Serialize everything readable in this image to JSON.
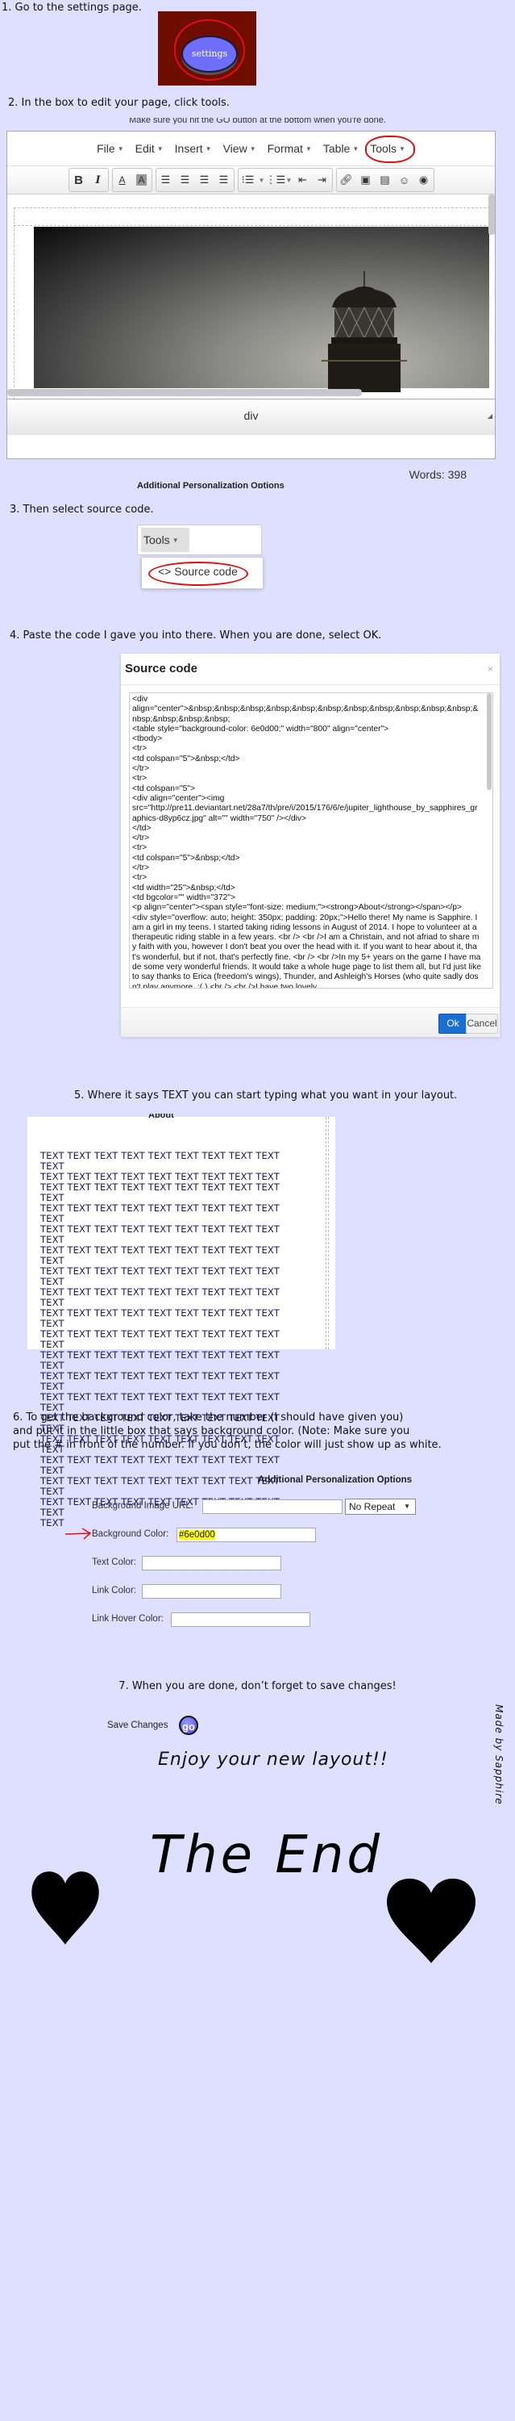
{
  "page": {
    "background_color": "#dfdfff",
    "steps": {
      "s1": "1. Go to the settings page.",
      "s2": "2. In the box to edit your page, click tools.",
      "s3": "3. Then select source code.",
      "s4": "4. Paste the code I gave you into there. When you are done, select OK.",
      "s5": "5. Where it says TEXT you can start typing what you want in your layout.",
      "s6_lines": [
        "6. To get the background color, take the number (I should have given you)",
        "and put it in the little box that says background color. (Note: Make sure you",
        "put the # in front of the number. If you don’t, the color will just show up as white."
      ],
      "s7": "7. When you are done, don’t forget to save changes!"
    }
  },
  "settings_button": {
    "label": "settings",
    "bg_color": "#6e0d00",
    "button_color": "#6e6efa"
  },
  "editor": {
    "cut_note": "Make sure you hit the GO button at the bottom when you're done.",
    "menus": [
      "File",
      "Edit",
      "Insert",
      "View",
      "Format",
      "Table",
      "Tools"
    ],
    "toolbar_icons": [
      "bold-icon",
      "italic-icon",
      "text-color-icon",
      "background-color-icon",
      "align-left-icon",
      "align-center-icon",
      "align-right-icon",
      "align-justify-icon",
      "bullet-list-icon",
      "numbered-list-icon",
      "outdent-icon",
      "indent-icon",
      "link-icon",
      "image-icon",
      "media-icon",
      "emoticon-icon",
      "preview-icon"
    ],
    "status_path": "div",
    "word_count": "Words: 398",
    "cut_heading": "Additional Personalization Options"
  },
  "tools_dropdown": {
    "menu_label": "Tools",
    "item_label": "Source code",
    "item_icon": "<>"
  },
  "source_dialog": {
    "title": "Source code",
    "close": "×",
    "code": "<div\nalign=\"center\">&nbsp;&nbsp;&nbsp;&nbsp;&nbsp;&nbsp;&nbsp;&nbsp;&nbsp;&nbsp;&nbsp;&nbsp;&nbsp;&nbsp;&nbsp;\n<table style=\"background-color: 6e0d00;\" width=\"800\" align=\"center\">\n<tbody>\n<tr>\n<td colspan=\"5\">&nbsp;</td>\n</tr>\n<tr>\n<td colspan=\"5\">\n<div align=\"center\"><img\nsrc=\"http://pre11.deviantart.net/28a7/th/pre/i/2015/176/6/e/jupiter_lighthouse_by_sapphires_graphics-d8yp6cz.jpg\" alt=\"\" width=\"750\" /></div>\n</td>\n</tr>\n<tr>\n<td colspan=\"5\">&nbsp;</td>\n</tr>\n<tr>\n<td width=\"25\">&nbsp;</td>\n<td bgcolor=\"\" width=\"372\">\n<p align=\"center\"><span style=\"font-size: medium;\"><strong>About</strong></span></p>\n<div style=\"overflow: auto; height: 350px; padding: 20px;\">Hello there! My name is Sapphire. I am a girl in my teens. I started taking riding lessons in August of 2014. I hope to volunteer at a therapeutic riding stable in a few years. <br /> <br />I am a Christain, and not afriad to share my faith with you, however I don't beat you over the head with it. If you want to hear about it, that's wonderful, but if not, that's perfectly fine. <br /> <br />In my 5+ years on the game I have made some very wonderful friends. It would take a whole huge page to list them all, but I'd just like to say thanks to Erica (freedom's wings), Thunder, and Ashleigh's Horses (who quite sadly dosn't play anymore. :( ) <br /> <br />I have two lovely",
    "ok_label": "Ok",
    "cancel_label": "Cancel",
    "ok_color": "#1a6ed0"
  },
  "text_preview": {
    "heading_cut": "About",
    "lines": [
      "TEXT TEXT TEXT TEXT TEXT TEXT TEXT TEXT TEXT TEXT",
      "TEXT TEXT TEXT TEXT TEXT TEXT TEXT TEXT TEXT",
      "TEXT TEXT TEXT TEXT TEXT TEXT TEXT TEXT TEXT TEXT",
      "TEXT TEXT TEXT TEXT TEXT TEXT TEXT TEXT TEXT TEXT",
      "TEXT TEXT TEXT TEXT TEXT TEXT TEXT TEXT TEXT TEXT",
      "TEXT TEXT TEXT TEXT TEXT TEXT TEXT TEXT TEXT TEXT",
      "TEXT TEXT TEXT TEXT TEXT TEXT TEXT TEXT TEXT TEXT",
      "TEXT TEXT TEXT TEXT TEXT TEXT TEXT TEXT TEXT TEXT",
      "TEXT TEXT TEXT TEXT TEXT TEXT TEXT TEXT TEXT TEXT",
      "TEXT TEXT TEXT TEXT TEXT TEXT TEXT TEXT TEXT TEXT",
      "TEXT TEXT TEXT TEXT TEXT TEXT TEXT TEXT TEXT TEXT",
      "TEXT TEXT TEXT TEXT TEXT TEXT TEXT TEXT TEXT TEXT",
      "TEXT TEXT TEXT TEXT TEXT TEXT TEXT TEXT TEXT TEXT",
      "TEXT TEXT TEXT TEXT TEXT TEXT TEXT TEXT TEXT TEXT",
      "TEXT TEXT TEXT TEXT TEXT TEXT TEXT TEXT TEXT TEXT",
      "TEXT TEXT TEXT TEXT TEXT TEXT TEXT TEXT TEXT TEXT",
      "TEXT TEXT TEXT TEXT TEXT TEXT TEXT TEXT TEXT TEXT",
      "TEXT TEXT TEXT TEXT TEXT TEXT TEXT TEXT TEXT TEXT",
      "TEXT"
    ]
  },
  "personalization": {
    "title": "Additional Personalization Options",
    "fields": {
      "bg_image_label": "Background Image URL:",
      "bg_image_value": "",
      "repeat_value": "No Repeat",
      "bg_color_label": "Background Color:",
      "bg_color_value": "#6e0d00",
      "text_color_label": "Text Color:",
      "text_color_value": "",
      "link_color_label": "Link Color:",
      "link_color_value": "",
      "link_hover_label": "Link Hover Color:",
      "link_hover_value": ""
    },
    "highlight_color": "#ffff00"
  },
  "save": {
    "label": "Save Changes",
    "go_label": "go"
  },
  "closing": {
    "enjoy": "Enjoy your new layout!!",
    "made_by": "Made by Sapphire",
    "the_end": "The End"
  }
}
